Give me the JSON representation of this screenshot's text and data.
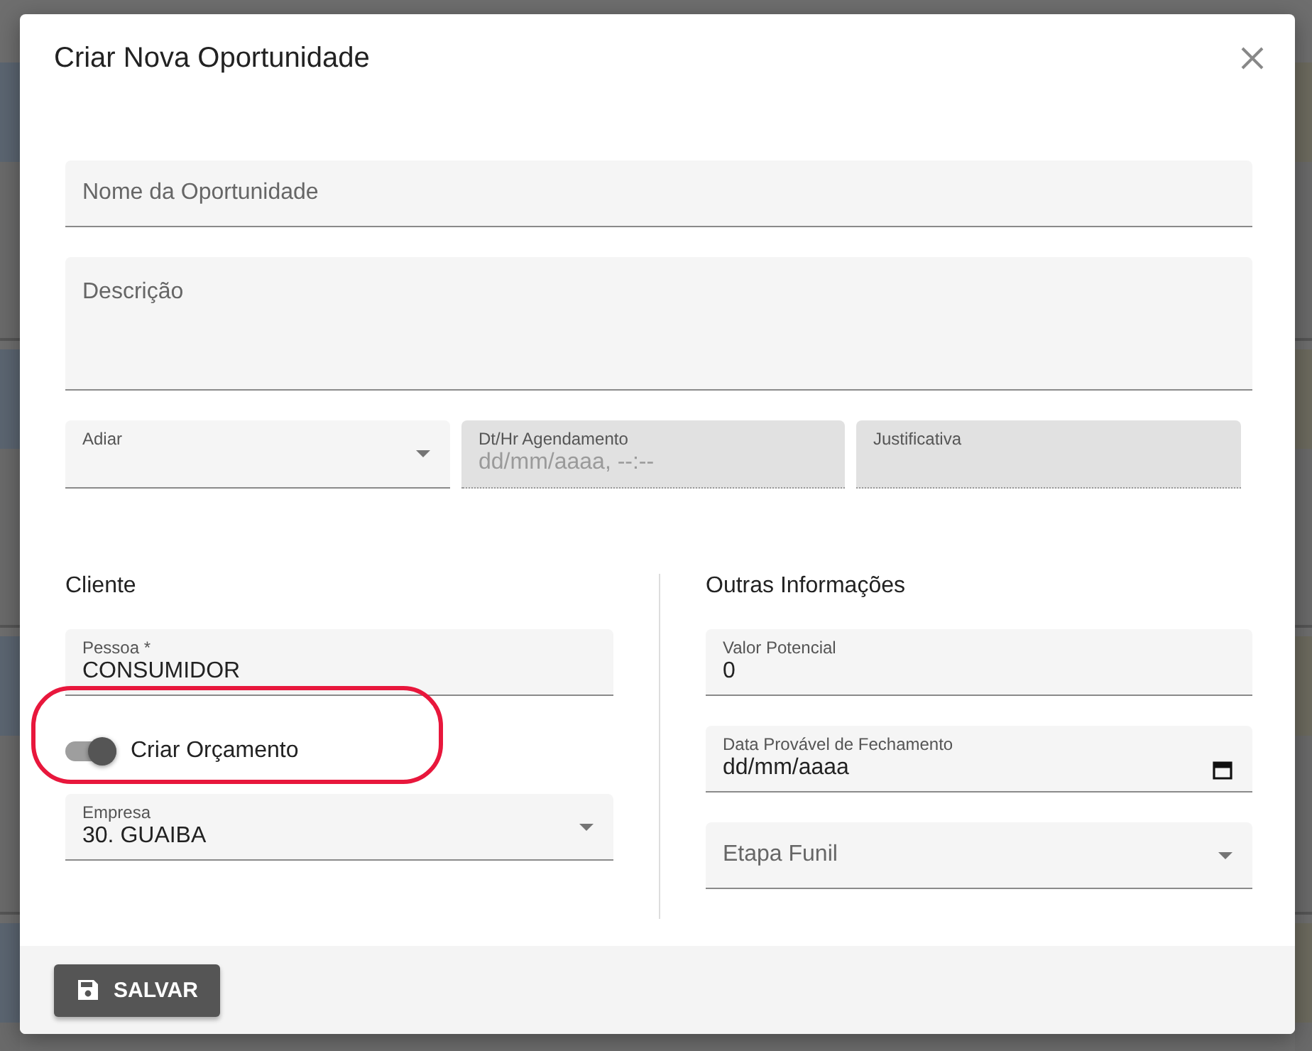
{
  "dialog": {
    "title": "Criar Nova Oportunidade",
    "fields": [
      {
        "kind": "text",
        "placeholder": "Nome da Oportunidade"
      },
      {
        "kind": "textarea",
        "placeholder": "Descrição"
      }
    ],
    "row": [
      {
        "kind": "select",
        "label": "Adiar",
        "disabled": false
      },
      {
        "kind": "datetime",
        "label": "Dt/Hr Agendamento",
        "placeholder": "dd/mm/aaaa, --:--",
        "disabled": true
      },
      {
        "kind": "text",
        "label": "Justificativa",
        "disabled": true
      }
    ],
    "sections": [
      {
        "heading": "Cliente",
        "items": [
          {
            "kind": "text",
            "label": "Pessoa *",
            "value": "CONSUMIDOR"
          },
          {
            "kind": "toggle",
            "label": "Criar Orçamento",
            "on": true,
            "highlighted": true
          },
          {
            "kind": "select",
            "label": "Empresa",
            "value": "30. GUAIBA"
          }
        ]
      },
      {
        "heading": "Outras Informações",
        "items": [
          {
            "kind": "text",
            "label": "Valor Potencial",
            "value": "0"
          },
          {
            "kind": "date",
            "placeholder": "Data Provável de Fechamento",
            "value": "dd/mm/aaaa"
          },
          {
            "kind": "select",
            "placeholder": "Etapa Funil"
          }
        ]
      }
    ],
    "save_button": "SALVAR"
  }
}
